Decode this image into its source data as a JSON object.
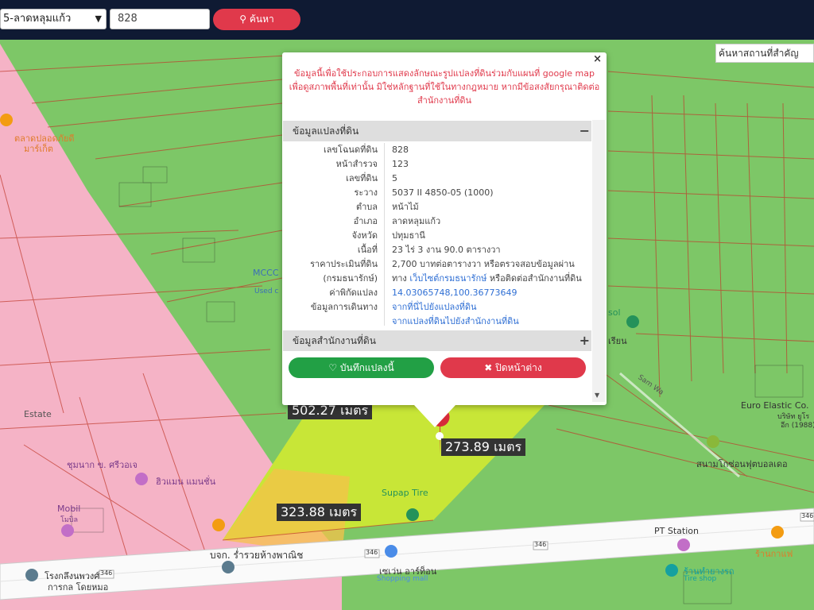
{
  "topbar": {
    "district_select": "5-ลาดหลุมแก้ว",
    "parcel_input": "828",
    "search_button": "ค้นหา"
  },
  "map": {
    "place_search_placeholder": "ค้นหาสถานที่สำคัญ",
    "distances": {
      "d1": "502.27 เมตร",
      "d2": "273.89 เมตร",
      "d3": "323.88 เมตร"
    },
    "labels": {
      "pt_station": "PT Station",
      "euro_elastic": "Euro Elastic Co.",
      "euro_elastic_sub": "บริษัท ยูโร",
      "euro_elastic_sub2": "อีก (1988)",
      "mobil": "Mobil",
      "mobil_sub": "โมบิล",
      "supap_tire": "Supap Tire",
      "road_name": "บจก. ร่ำรวยห้างพาณิช",
      "seven_eleven": "เซเว่น อาร์ท็อน",
      "shopping_mall": "Shopping mall",
      "hospital": "โรงกลึงนพวงศ์",
      "hospital_sub": "การกล โดยหมอ",
      "cafe": "ร้านกาแฟ",
      "tire_shop": "ร้านทำยางรถ",
      "tire_shop_sub": "Tire shop",
      "sanam": "สนามโกซ่อนฟุตบอลเดอ",
      "mccc": "MCCC",
      "used_c": "Used c",
      "sam_wa": "Sam Wa",
      "sol": "sol",
      "rian": "เรียน",
      "route": "346",
      "sum_nag": "ชุมนาก ข. ศรีวอเจ",
      "hiwaii": "ฮิวแมน แมนชั่น",
      "talat": "ตลาดปลอดภัยดี",
      "market": "มาร์เก็ต",
      "estate": "Estate"
    },
    "colors": {
      "parcel_pink": "#f5b3c6",
      "parcel_green": "#7dc767",
      "highlight": "#c8e637",
      "zone_yellow": "#f6c24a",
      "boundary": "#c0392b"
    }
  },
  "popup": {
    "close_icon": "×",
    "note": "ข้อมูลนี้เพื่อใช้ประกอบการแสดงลักษณะรูปแปลงที่ดินร่วมกับแผนที่ google map เพื่อดูสภาพพื้นที่เท่านั้น มิใช่หลักฐานที่ใช้ในทางกฎหมาย หากมีข้อสงสัยกรุณาติดต่อสำนักงานที่ดิน",
    "section_parcel": "ข้อมูลแปลงที่ดิน",
    "section_parcel_toggle": "−",
    "rows": [
      {
        "k": "เลขโฉนดที่ดิน",
        "v": "828"
      },
      {
        "k": "หน้าสำรวจ",
        "v": "123"
      },
      {
        "k": "เลขที่ดิน",
        "v": "5"
      },
      {
        "k": "ระวาง",
        "v": "5037 II 4850-05 (1000)"
      },
      {
        "k": "ตำบล",
        "v": "หน้าไม้"
      },
      {
        "k": "อำเภอ",
        "v": "ลาดหลุมแก้ว"
      },
      {
        "k": "จังหวัด",
        "v": "ปทุมธานี"
      },
      {
        "k": "เนื้อที่",
        "v": "23 ไร่ 3 งาน 90.0 ตารางวา"
      },
      {
        "k": "ราคาประเมินที่ดิน",
        "v": "2,700 บาทต่อตารางวา หรือตรวจสอบข้อมูลผ่าน"
      },
      {
        "k": "(กรมธนารักษ์)",
        "v": "ทาง",
        "link": "เว็บไซต์กรมธนารักษ์",
        "v2": " หรือติดต่อสำนักงานที่ดิน"
      },
      {
        "k": "ค่าพิกัดแปลง",
        "link": "14.03065748,100.36773649"
      },
      {
        "k": "ข้อมูลการเดินทาง",
        "link": "จากที่นี่ไปยังแปลงที่ดิน"
      },
      {
        "k": "",
        "link": "จากแปลงที่ดินไปยังสำนักงานที่ดิน"
      }
    ],
    "section_office": "ข้อมูลสำนักงานที่ดิน",
    "section_office_toggle": "+",
    "save_button": "บันทึกแปลงนี้",
    "close_button": "ปิดหน้าต่าง",
    "save_color": "#22a045",
    "close_color": "#e0394b"
  }
}
